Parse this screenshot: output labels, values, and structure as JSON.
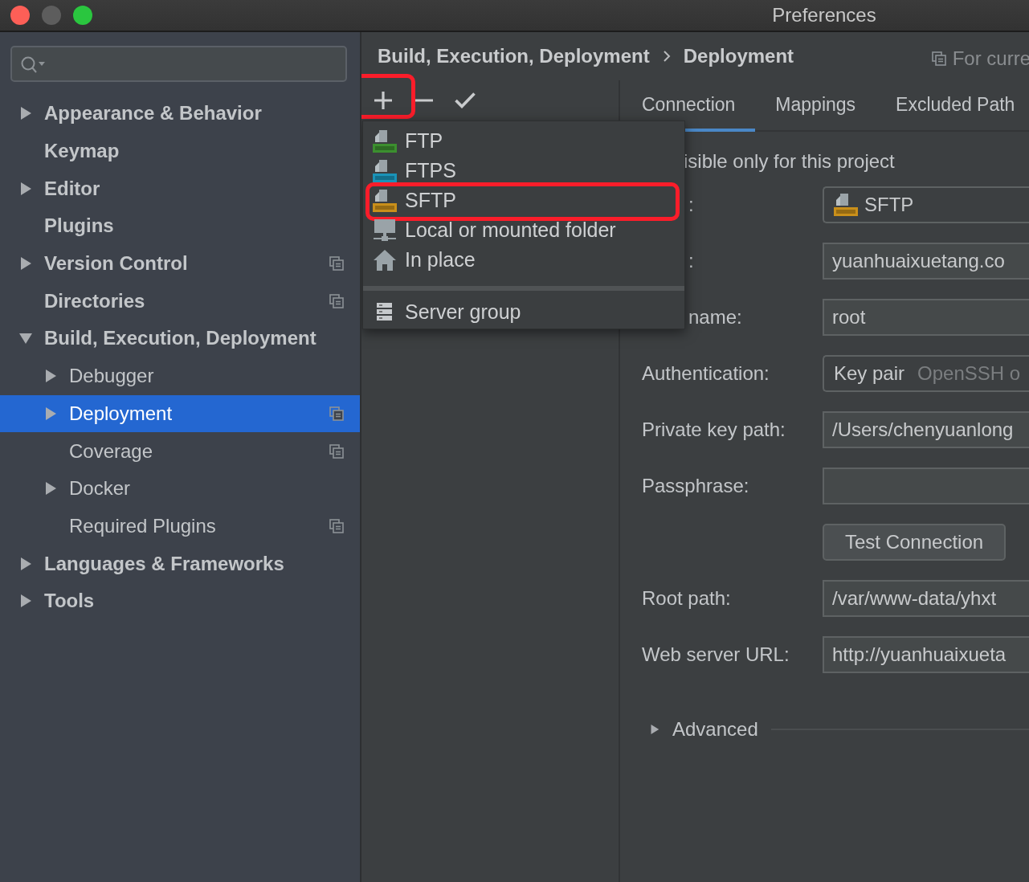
{
  "window": {
    "title": "Preferences"
  },
  "sidebar": {
    "items": [
      {
        "label": "Appearance & Behavior",
        "expanded": false,
        "selected": false,
        "project_scoped": false
      },
      {
        "label": "Keymap",
        "selected": false,
        "project_scoped": false
      },
      {
        "label": "Editor",
        "expanded": false,
        "selected": false,
        "project_scoped": false
      },
      {
        "label": "Plugins",
        "selected": false,
        "project_scoped": false
      },
      {
        "label": "Version Control",
        "expanded": false,
        "selected": false,
        "project_scoped": true
      },
      {
        "label": "Directories",
        "selected": false,
        "project_scoped": true
      },
      {
        "label": "Build, Execution, Deployment",
        "expanded": true,
        "selected": false,
        "project_scoped": false,
        "children": [
          {
            "label": "Debugger",
            "expanded": false,
            "selected": false,
            "project_scoped": false
          },
          {
            "label": "Deployment",
            "expanded": false,
            "selected": true,
            "project_scoped": true
          },
          {
            "label": "Coverage",
            "selected": false,
            "project_scoped": true
          },
          {
            "label": "Docker",
            "expanded": false,
            "selected": false,
            "project_scoped": false
          },
          {
            "label": "Required Plugins",
            "selected": false,
            "project_scoped": true
          }
        ]
      },
      {
        "label": "Languages & Frameworks",
        "expanded": false,
        "selected": false,
        "project_scoped": false
      },
      {
        "label": "Tools",
        "expanded": false,
        "selected": false,
        "project_scoped": false
      }
    ]
  },
  "breadcrumb": [
    "Build, Execution, Deployment",
    "Deployment"
  ],
  "scope_hint": "For curre",
  "toolbar": [
    {
      "kind": "add",
      "highlighted": true
    },
    {
      "kind": "remove",
      "highlighted": false
    },
    {
      "kind": "apply",
      "highlighted": false
    }
  ],
  "add_menu": {
    "items": [
      {
        "kind": "ftp",
        "label": "FTP",
        "highlighted": false
      },
      {
        "kind": "ftps",
        "label": "FTPS",
        "highlighted": false
      },
      {
        "kind": "sftp",
        "label": "SFTP",
        "highlighted": true
      },
      {
        "kind": "folder",
        "label": "Local or mounted folder",
        "highlighted": false
      },
      {
        "kind": "home",
        "label": "In place",
        "highlighted": false
      },
      {
        "kind": "group",
        "label": "Server group",
        "highlighted": false
      }
    ]
  },
  "tabs": [
    {
      "label": "Connection",
      "selected": true
    },
    {
      "label": "Mappings",
      "selected": false
    },
    {
      "label": "Excluded Path",
      "selected": false
    }
  ],
  "visibility_text": "isible only for this project",
  "fields": [
    {
      "kind": "server_type",
      "label": ":",
      "partly_hidden": true,
      "value": "SFTP"
    },
    {
      "kind": "text",
      "label": ":",
      "partly_hidden": true,
      "value": "yuanhuaixuetang.co"
    },
    {
      "kind": "text",
      "label": "name:",
      "partly_hidden": true,
      "value": "root"
    },
    {
      "kind": "dropdown",
      "label": "Authentication:",
      "partly_hidden": false,
      "value": "Key pair",
      "hint": "OpenSSH o"
    },
    {
      "kind": "text",
      "label": "Private key path:",
      "partly_hidden": false,
      "value": "/Users/chenyuanlong"
    },
    {
      "kind": "text",
      "label": "Passphrase:",
      "partly_hidden": false
    },
    {
      "kind": "button",
      "value": "Test Connection"
    },
    {
      "kind": "text",
      "label": "Root path:",
      "partly_hidden": false,
      "value": "/var/www-data/yhxt"
    },
    {
      "kind": "text",
      "label": "Web server URL:",
      "partly_hidden": false,
      "value": "http://yuanhuaixueta"
    }
  ],
  "advanced": {
    "label": "Advanced",
    "expanded": false
  }
}
